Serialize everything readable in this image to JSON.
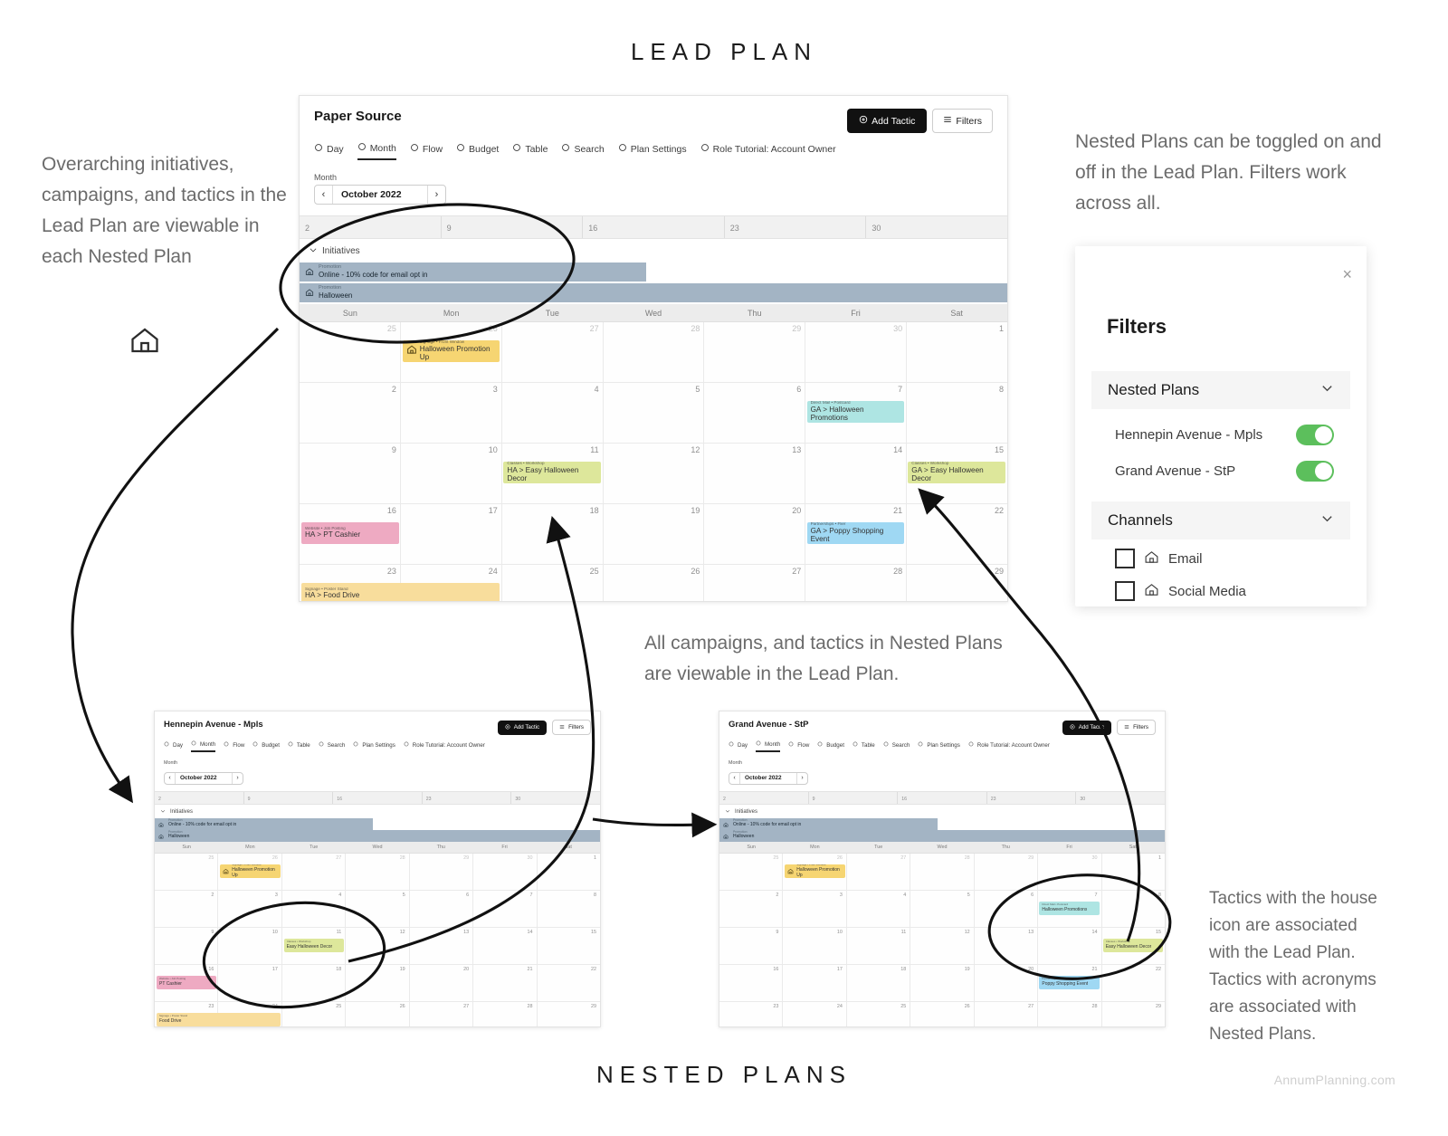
{
  "headings": {
    "lead_plan": "LEAD PLAN",
    "nested_plans": "NESTED PLANS",
    "footer_credit": "AnnumPlanning.com"
  },
  "annotations": {
    "left": "Overarching initiatives, campaigns, and tactics in the Lead Plan are viewable in each Nested Plan",
    "right_top": "Nested Plans can be toggled on and off in the Lead Plan. Filters work across all.",
    "middle": "All campaigns, and tactics in Nested Plans are viewable in the Lead Plan.",
    "right_bottom": "Tactics with the house icon are associated with the Lead Plan. Tactics with acronyms are associated with Nested Plans."
  },
  "icons": {
    "house": "house-icon",
    "chevron_down": "chevron-down-icon",
    "chevron_left": "chevron-left-icon",
    "chevron_right": "chevron-right-icon",
    "close": "close-icon",
    "plus_circle": "plus-circle-icon",
    "sliders": "sliders-icon"
  },
  "lead_plan": {
    "plan_name": "Paper Source",
    "add_tactic_label": "Add Tactic",
    "filters_label": "Filters",
    "nav": [
      {
        "label": "Day",
        "icon": "clock-icon",
        "active": false
      },
      {
        "label": "Month",
        "icon": "calendar-icon",
        "active": true
      },
      {
        "label": "Flow",
        "icon": "flow-icon",
        "active": false
      },
      {
        "label": "Budget",
        "icon": "dollar-icon",
        "active": false
      },
      {
        "label": "Table",
        "icon": "table-icon",
        "active": false
      },
      {
        "label": "Search",
        "icon": "search-icon",
        "active": false
      },
      {
        "label": "Plan Settings",
        "icon": "gear-icon",
        "active": false
      },
      {
        "label": "Role Tutorial: Account Owner",
        "icon": "info-icon",
        "active": false
      }
    ],
    "month_label": "Month",
    "month_value": "October 2022",
    "week_ruler": [
      "2",
      "9",
      "16",
      "23",
      "30"
    ],
    "initiatives_label": "Initiatives",
    "initiatives": [
      {
        "kicker": "Promotion",
        "name": "Online - 10% code for email opt in",
        "start_pct": 0,
        "width_pct": 49
      },
      {
        "kicker": "Promotion",
        "name": "Halloween",
        "start_pct": 0,
        "width_pct": 100
      }
    ],
    "day_headers": [
      "Sun",
      "Mon",
      "Tue",
      "Wed",
      "Thu",
      "Fri",
      "Sat"
    ],
    "weeks": [
      {
        "days": [
          {
            "num": "25",
            "muted": true
          },
          {
            "num": "26",
            "muted": true
          },
          {
            "num": "27",
            "muted": true
          },
          {
            "num": "28",
            "muted": true
          },
          {
            "num": "29",
            "muted": true
          },
          {
            "num": "30",
            "muted": true
          },
          {
            "num": "1",
            "muted": false
          }
        ]
      },
      {
        "days": [
          {
            "num": "2",
            "muted": false
          },
          {
            "num": "3",
            "muted": false
          },
          {
            "num": "4",
            "muted": false
          },
          {
            "num": "5",
            "muted": false
          },
          {
            "num": "6",
            "muted": false
          },
          {
            "num": "7",
            "muted": false
          },
          {
            "num": "8",
            "muted": false
          }
        ]
      },
      {
        "days": [
          {
            "num": "9",
            "muted": false
          },
          {
            "num": "10",
            "muted": false
          },
          {
            "num": "11",
            "muted": false
          },
          {
            "num": "12",
            "muted": false
          },
          {
            "num": "13",
            "muted": false
          },
          {
            "num": "14",
            "muted": false
          },
          {
            "num": "15",
            "muted": false
          }
        ]
      },
      {
        "days": [
          {
            "num": "16",
            "muted": false
          },
          {
            "num": "17",
            "muted": false
          },
          {
            "num": "18",
            "muted": false
          },
          {
            "num": "19",
            "muted": false
          },
          {
            "num": "20",
            "muted": false
          },
          {
            "num": "21",
            "muted": false
          },
          {
            "num": "22",
            "muted": false
          }
        ]
      },
      {
        "days": [
          {
            "num": "23",
            "muted": false
          },
          {
            "num": "24",
            "muted": false
          },
          {
            "num": "25",
            "muted": false
          },
          {
            "num": "26",
            "muted": false
          },
          {
            "num": "27",
            "muted": false
          },
          {
            "num": "28",
            "muted": false
          },
          {
            "num": "29",
            "muted": false
          }
        ]
      }
    ],
    "tactics": [
      {
        "week": 0,
        "col": 1,
        "span": 1.0,
        "kicker": "Signage • Front Window",
        "name": "Halloween Promotion Up",
        "color": "#f6d572",
        "house": true
      },
      {
        "week": 1,
        "col": 5,
        "span": 1.0,
        "kicker": "Direct Mail • Postcard",
        "name": "GA > Halloween Promotions",
        "color": "#aee5e3",
        "house": false
      },
      {
        "week": 2,
        "col": 2,
        "span": 1.0,
        "kicker": "Classes • Workshop",
        "name": "HA > Easy Halloween Decor",
        "color": "#dde79b",
        "house": false
      },
      {
        "week": 2,
        "col": 6,
        "span": 1.0,
        "kicker": "Classes • Workshop",
        "name": "GA > Easy Halloween Decor",
        "color": "#dde79b",
        "house": false
      },
      {
        "week": 3,
        "col": 0,
        "span": 1.0,
        "kicker": "Website • Job Posting",
        "name": "HA > PT Cashier",
        "color": "#eeaac2",
        "house": false
      },
      {
        "week": 3,
        "col": 5,
        "span": 1.0,
        "kicker": "Partnerships • Flier",
        "name": "GA > Poppy Shopping Event",
        "color": "#9fd8f3",
        "house": false
      },
      {
        "week": 4,
        "col": 0,
        "span": 2.0,
        "kicker": "Signage • Poster Stand",
        "name": "HA > Food Drive",
        "color": "#f8dd9c",
        "house": false
      }
    ]
  },
  "nested_plans": [
    {
      "id": "hennepin",
      "plan_name": "Hennepin Avenue - Mpls",
      "add_tactic_label": "Add Tactic",
      "filters_label": "Filters",
      "nav": [
        {
          "label": "Day",
          "active": false
        },
        {
          "label": "Month",
          "active": true
        },
        {
          "label": "Flow",
          "active": false
        },
        {
          "label": "Budget",
          "active": false
        },
        {
          "label": "Table",
          "active": false
        },
        {
          "label": "Search",
          "active": false
        },
        {
          "label": "Plan Settings",
          "active": false
        },
        {
          "label": "Role Tutorial: Account Owner",
          "active": false
        }
      ],
      "month_label": "Month",
      "month_value": "October 2022",
      "week_ruler": [
        "2",
        "9",
        "16",
        "23",
        "30"
      ],
      "initiatives_label": "Initiatives",
      "initiatives": [
        {
          "kicker": "Promotion",
          "name": "Online - 10% code for email opt in",
          "start_pct": 0,
          "width_pct": 49
        },
        {
          "kicker": "Promotion",
          "name": "Halloween",
          "start_pct": 0,
          "width_pct": 100
        }
      ],
      "day_headers": [
        "Sun",
        "Mon",
        "Tue",
        "Wed",
        "Thu",
        "Fri",
        "Sat"
      ],
      "weeks": [
        {
          "days": [
            {
              "num": "25",
              "muted": true
            },
            {
              "num": "26",
              "muted": true
            },
            {
              "num": "27",
              "muted": true
            },
            {
              "num": "28",
              "muted": true
            },
            {
              "num": "29",
              "muted": true
            },
            {
              "num": "30",
              "muted": true
            },
            {
              "num": "1",
              "muted": false
            }
          ]
        },
        {
          "days": [
            {
              "num": "2",
              "muted": false
            },
            {
              "num": "3",
              "muted": false
            },
            {
              "num": "4",
              "muted": false
            },
            {
              "num": "5",
              "muted": false
            },
            {
              "num": "6",
              "muted": false
            },
            {
              "num": "7",
              "muted": false
            },
            {
              "num": "8",
              "muted": false
            }
          ]
        },
        {
          "days": [
            {
              "num": "9",
              "muted": false
            },
            {
              "num": "10",
              "muted": false
            },
            {
              "num": "11",
              "muted": false
            },
            {
              "num": "12",
              "muted": false
            },
            {
              "num": "13",
              "muted": false
            },
            {
              "num": "14",
              "muted": false
            },
            {
              "num": "15",
              "muted": false
            }
          ]
        },
        {
          "days": [
            {
              "num": "16",
              "muted": false
            },
            {
              "num": "17",
              "muted": false
            },
            {
              "num": "18",
              "muted": false
            },
            {
              "num": "19",
              "muted": false
            },
            {
              "num": "20",
              "muted": false
            },
            {
              "num": "21",
              "muted": false
            },
            {
              "num": "22",
              "muted": false
            }
          ]
        },
        {
          "days": [
            {
              "num": "23",
              "muted": false
            },
            {
              "num": "24",
              "muted": false
            },
            {
              "num": "25",
              "muted": false
            },
            {
              "num": "26",
              "muted": false
            },
            {
              "num": "27",
              "muted": false
            },
            {
              "num": "28",
              "muted": false
            },
            {
              "num": "29",
              "muted": false
            }
          ]
        }
      ],
      "tactics": [
        {
          "week": 0,
          "col": 1,
          "span": 1.0,
          "kicker": "Signage • Front Window",
          "name": "Halloween Promotion Up",
          "color": "#f6d572",
          "house": true
        },
        {
          "week": 2,
          "col": 2,
          "span": 1.0,
          "kicker": "Classes • Workshop",
          "name": "Easy Halloween Decor",
          "color": "#dde79b",
          "house": false
        },
        {
          "week": 3,
          "col": 0,
          "span": 1.0,
          "kicker": "Website • Job Posting",
          "name": "PT Cashier",
          "color": "#eeaac2",
          "house": false
        },
        {
          "week": 4,
          "col": 0,
          "span": 2.0,
          "kicker": "Signage • Poster Stand",
          "name": "Food Drive",
          "color": "#f8dd9c",
          "house": false
        }
      ]
    },
    {
      "id": "grand",
      "plan_name": "Grand Avenue - StP",
      "add_tactic_label": "Add Tactic",
      "filters_label": "Filters",
      "nav": [
        {
          "label": "Day",
          "active": false
        },
        {
          "label": "Month",
          "active": true
        },
        {
          "label": "Flow",
          "active": false
        },
        {
          "label": "Budget",
          "active": false
        },
        {
          "label": "Table",
          "active": false
        },
        {
          "label": "Search",
          "active": false
        },
        {
          "label": "Plan Settings",
          "active": false
        },
        {
          "label": "Role Tutorial: Account Owner",
          "active": false
        }
      ],
      "month_label": "Month",
      "month_value": "October 2022",
      "week_ruler": [
        "2",
        "9",
        "16",
        "23",
        "30"
      ],
      "initiatives_label": "Initiatives",
      "initiatives": [
        {
          "kicker": "Promotion",
          "name": "Online - 10% code for email opt in",
          "start_pct": 0,
          "width_pct": 49
        },
        {
          "kicker": "Promotion",
          "name": "Halloween",
          "start_pct": 0,
          "width_pct": 100
        }
      ],
      "day_headers": [
        "Sun",
        "Mon",
        "Tue",
        "Wed",
        "Thu",
        "Fri",
        "Sat"
      ],
      "weeks": [
        {
          "days": [
            {
              "num": "25",
              "muted": true
            },
            {
              "num": "26",
              "muted": true
            },
            {
              "num": "27",
              "muted": true
            },
            {
              "num": "28",
              "muted": true
            },
            {
              "num": "29",
              "muted": true
            },
            {
              "num": "30",
              "muted": true
            },
            {
              "num": "1",
              "muted": false
            }
          ]
        },
        {
          "days": [
            {
              "num": "2",
              "muted": false
            },
            {
              "num": "3",
              "muted": false
            },
            {
              "num": "4",
              "muted": false
            },
            {
              "num": "5",
              "muted": false
            },
            {
              "num": "6",
              "muted": false
            },
            {
              "num": "7",
              "muted": false
            },
            {
              "num": "8",
              "muted": false
            }
          ]
        },
        {
          "days": [
            {
              "num": "9",
              "muted": false
            },
            {
              "num": "10",
              "muted": false
            },
            {
              "num": "11",
              "muted": false
            },
            {
              "num": "12",
              "muted": false
            },
            {
              "num": "13",
              "muted": false
            },
            {
              "num": "14",
              "muted": false
            },
            {
              "num": "15",
              "muted": false
            }
          ]
        },
        {
          "days": [
            {
              "num": "16",
              "muted": false
            },
            {
              "num": "17",
              "muted": false
            },
            {
              "num": "18",
              "muted": false
            },
            {
              "num": "19",
              "muted": false
            },
            {
              "num": "20",
              "muted": false
            },
            {
              "num": "21",
              "muted": false
            },
            {
              "num": "22",
              "muted": false
            }
          ]
        },
        {
          "days": [
            {
              "num": "23",
              "muted": false
            },
            {
              "num": "24",
              "muted": false
            },
            {
              "num": "25",
              "muted": false
            },
            {
              "num": "26",
              "muted": false
            },
            {
              "num": "27",
              "muted": false
            },
            {
              "num": "28",
              "muted": false
            },
            {
              "num": "29",
              "muted": false
            }
          ]
        }
      ],
      "tactics": [
        {
          "week": 0,
          "col": 1,
          "span": 1.0,
          "kicker": "Signage • Front Window",
          "name": "Halloween Promotion Up",
          "color": "#f6d572",
          "house": true
        },
        {
          "week": 1,
          "col": 5,
          "span": 1.0,
          "kicker": "Direct Mail • Postcard",
          "name": "Halloween Promotions",
          "color": "#aee5e3",
          "house": false
        },
        {
          "week": 2,
          "col": 6,
          "span": 1.0,
          "kicker": "Classes • Workshop",
          "name": "Easy Halloween Decor",
          "color": "#dde79b",
          "house": false
        },
        {
          "week": 3,
          "col": 5,
          "span": 1.0,
          "kicker": "Partnerships • Flier",
          "name": "Poppy Shopping Event",
          "color": "#9fd8f3",
          "house": false
        }
      ]
    }
  ],
  "filters_panel": {
    "title": "Filters",
    "close_label": "×",
    "sections": [
      {
        "label": "Nested Plans"
      },
      {
        "label": "Channels"
      }
    ],
    "nested_plan_toggles": [
      {
        "label": "Hennepin Avenue - Mpls",
        "on": true
      },
      {
        "label": "Grand Avenue - StP",
        "on": true
      }
    ],
    "channels": [
      {
        "label": "Email",
        "checked": false
      },
      {
        "label": "Social Media",
        "checked": false
      }
    ],
    "toggle_on_color": "#5cbf5c"
  }
}
